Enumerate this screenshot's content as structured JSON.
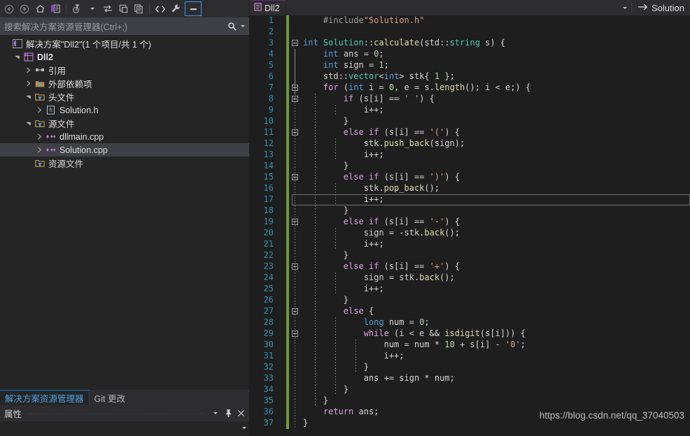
{
  "solution_explorer": {
    "toolbar": [
      {
        "name": "back-icon",
        "title": "Back"
      },
      {
        "name": "forward-icon",
        "title": "Forward"
      },
      {
        "name": "home-icon",
        "title": "Home"
      },
      {
        "name": "sync-with-active-document-icon",
        "title": "Sync"
      },
      {
        "name": "pending-changes-filter-icon",
        "title": "Filter"
      },
      {
        "name": "refresh-icon",
        "title": "Refresh"
      },
      {
        "name": "collapse-all-icon",
        "title": "Collapse All"
      },
      {
        "name": "show-all-files-icon",
        "title": "Show All Files"
      },
      {
        "name": "code-view-icon",
        "title": "View Code"
      },
      {
        "name": "properties-wrench-icon",
        "title": "Properties"
      },
      {
        "name": "preview-selected-items-icon",
        "title": "Preview Selected Items"
      }
    ],
    "search": {
      "placeholder": "搜索解决方案资源管理器(Ctrl+;)",
      "icon": "search-icon",
      "dropdown_icon": "chevron-down-icon"
    },
    "tree": [
      {
        "label": "解决方案\"Dll2\"(1 个项目/共 1 个)",
        "indent": 0,
        "expander": "none",
        "icon": "visual-studio-solution-icon",
        "bold": false,
        "selected": false
      },
      {
        "label": "Dll2",
        "indent": 1,
        "expander": "expanded",
        "icon": "project-icon",
        "bold": true,
        "selected": false
      },
      {
        "label": "引用",
        "indent": 2,
        "expander": "collapsed",
        "icon": "references-icon",
        "bold": false,
        "selected": false
      },
      {
        "label": "外部依赖项",
        "indent": 2,
        "expander": "collapsed",
        "icon": "external-dependencies-icon",
        "bold": false,
        "selected": false
      },
      {
        "label": "头文件",
        "indent": 2,
        "expander": "expanded",
        "icon": "filter-folder-icon",
        "bold": false,
        "selected": false
      },
      {
        "label": "Solution.h",
        "indent": 3,
        "expander": "collapsed",
        "icon": "header-file-icon",
        "bold": false,
        "selected": false
      },
      {
        "label": "源文件",
        "indent": 2,
        "expander": "expanded",
        "icon": "filter-folder-icon",
        "bold": false,
        "selected": false
      },
      {
        "label": "dllmain.cpp",
        "indent": 3,
        "expander": "collapsed",
        "icon": "cpp-file-icon",
        "bold": false,
        "selected": false
      },
      {
        "label": "Solution.cpp",
        "indent": 3,
        "expander": "collapsed",
        "icon": "cpp-file-icon",
        "bold": false,
        "selected": true
      },
      {
        "label": "资源文件",
        "indent": 2,
        "expander": "none",
        "icon": "filter-folder-icon",
        "bold": false,
        "selected": false
      }
    ],
    "bottom_tabs": [
      {
        "label": "解决方案资源管理器",
        "active": true
      },
      {
        "label": "Git 更改",
        "active": false
      }
    ]
  },
  "properties_panel": {
    "title": "属性",
    "buttons": [
      {
        "name": "window-dropdown-icon"
      },
      {
        "name": "pin-icon"
      },
      {
        "name": "close-icon"
      }
    ]
  },
  "editor": {
    "tab": {
      "label": "Dll2",
      "icon": "document-icon"
    },
    "tabstrip_dropdown_icon": "chevron-down-icon",
    "solution_button": {
      "label": "Solution",
      "icon": "arrow-right-icon"
    },
    "caret_line": 17,
    "lines": [
      {
        "n": 1,
        "fold": false,
        "bars": 0,
        "solidbar": false,
        "tokens": [
          {
            "t": "    ",
            "c": "plain"
          },
          {
            "t": "#include",
            "c": "pp"
          },
          {
            "t": "\"Solution.h\"",
            "c": "str"
          }
        ]
      },
      {
        "n": 2,
        "fold": false,
        "bars": 0,
        "solidbar": false,
        "tokens": []
      },
      {
        "n": 3,
        "fold": true,
        "bars": 0,
        "solidbar": false,
        "tokens": [
          {
            "t": "int",
            "c": "kw"
          },
          {
            "t": " ",
            "c": "plain"
          },
          {
            "t": "Solution",
            "c": "typ"
          },
          {
            "t": "::",
            "c": "plain"
          },
          {
            "t": "calculate",
            "c": "fn"
          },
          {
            "t": "(",
            "c": "plain"
          },
          {
            "t": "std",
            "c": "plain"
          },
          {
            "t": "::",
            "c": "plain"
          },
          {
            "t": "string",
            "c": "typ"
          },
          {
            "t": " s) {",
            "c": "plain"
          }
        ]
      },
      {
        "n": 4,
        "fold": false,
        "bars": 1,
        "solidbar": true,
        "tokens": [
          {
            "t": "    ",
            "c": "plain"
          },
          {
            "t": "int",
            "c": "kw"
          },
          {
            "t": " ans = ",
            "c": "plain"
          },
          {
            "t": "0",
            "c": "num"
          },
          {
            "t": ";",
            "c": "plain"
          }
        ]
      },
      {
        "n": 5,
        "fold": false,
        "bars": 1,
        "solidbar": true,
        "tokens": [
          {
            "t": "    ",
            "c": "plain"
          },
          {
            "t": "int",
            "c": "kw"
          },
          {
            "t": " sign = ",
            "c": "plain"
          },
          {
            "t": "1",
            "c": "num"
          },
          {
            "t": ";",
            "c": "plain"
          }
        ]
      },
      {
        "n": 6,
        "fold": false,
        "bars": 1,
        "solidbar": true,
        "tokens": [
          {
            "t": "    std::",
            "c": "plain"
          },
          {
            "t": "vector",
            "c": "typ"
          },
          {
            "t": "<",
            "c": "plain"
          },
          {
            "t": "int",
            "c": "kw"
          },
          {
            "t": "> stk{ ",
            "c": "plain"
          },
          {
            "t": "1",
            "c": "num"
          },
          {
            "t": " };",
            "c": "plain"
          }
        ]
      },
      {
        "n": 7,
        "fold": true,
        "bars": 1,
        "solidbar": true,
        "tokens": [
          {
            "t": "    ",
            "c": "plain"
          },
          {
            "t": "for",
            "c": "ctrl"
          },
          {
            "t": " (",
            "c": "plain"
          },
          {
            "t": "int",
            "c": "kw"
          },
          {
            "t": " i = ",
            "c": "plain"
          },
          {
            "t": "0",
            "c": "num"
          },
          {
            "t": ", e = s.",
            "c": "plain"
          },
          {
            "t": "length",
            "c": "fn"
          },
          {
            "t": "(); i < e;) {",
            "c": "plain"
          }
        ]
      },
      {
        "n": 8,
        "fold": true,
        "bars": 2,
        "solidbar": false,
        "tokens": [
          {
            "t": "        ",
            "c": "plain"
          },
          {
            "t": "if",
            "c": "ctrl"
          },
          {
            "t": " (s[i] == ",
            "c": "plain"
          },
          {
            "t": "' '",
            "c": "str"
          },
          {
            "t": ") {",
            "c": "plain"
          }
        ]
      },
      {
        "n": 9,
        "fold": false,
        "bars": 3,
        "solidbar": false,
        "tokens": [
          {
            "t": "            i++;",
            "c": "plain"
          }
        ]
      },
      {
        "n": 10,
        "fold": false,
        "bars": 2,
        "solidbar": false,
        "tokens": [
          {
            "t": "        }",
            "c": "plain"
          }
        ]
      },
      {
        "n": 11,
        "fold": true,
        "bars": 2,
        "solidbar": false,
        "tokens": [
          {
            "t": "        ",
            "c": "plain"
          },
          {
            "t": "else if",
            "c": "ctrl"
          },
          {
            "t": " (s[i] == ",
            "c": "plain"
          },
          {
            "t": "'('",
            "c": "str"
          },
          {
            "t": ") {",
            "c": "plain"
          }
        ]
      },
      {
        "n": 12,
        "fold": false,
        "bars": 3,
        "solidbar": false,
        "tokens": [
          {
            "t": "            stk.",
            "c": "plain"
          },
          {
            "t": "push_back",
            "c": "fn"
          },
          {
            "t": "(sign);",
            "c": "plain"
          }
        ]
      },
      {
        "n": 13,
        "fold": false,
        "bars": 3,
        "solidbar": false,
        "tokens": [
          {
            "t": "            i++;",
            "c": "plain"
          }
        ]
      },
      {
        "n": 14,
        "fold": false,
        "bars": 2,
        "solidbar": false,
        "tokens": [
          {
            "t": "        }",
            "c": "plain"
          }
        ]
      },
      {
        "n": 15,
        "fold": true,
        "bars": 2,
        "solidbar": false,
        "tokens": [
          {
            "t": "        ",
            "c": "plain"
          },
          {
            "t": "else if",
            "c": "ctrl"
          },
          {
            "t": " (s[i] == ",
            "c": "plain"
          },
          {
            "t": "')'",
            "c": "str"
          },
          {
            "t": ") {",
            "c": "plain"
          }
        ]
      },
      {
        "n": 16,
        "fold": false,
        "bars": 3,
        "solidbar": false,
        "tokens": [
          {
            "t": "            stk.",
            "c": "plain"
          },
          {
            "t": "pop_back",
            "c": "fn"
          },
          {
            "t": "();",
            "c": "plain"
          }
        ]
      },
      {
        "n": 17,
        "fold": false,
        "bars": 3,
        "solidbar": false,
        "tokens": [
          {
            "t": "            i++;",
            "c": "plain"
          }
        ]
      },
      {
        "n": 18,
        "fold": false,
        "bars": 2,
        "solidbar": false,
        "tokens": [
          {
            "t": "        }",
            "c": "plain"
          }
        ]
      },
      {
        "n": 19,
        "fold": true,
        "bars": 2,
        "solidbar": false,
        "tokens": [
          {
            "t": "        ",
            "c": "plain"
          },
          {
            "t": "else if",
            "c": "ctrl"
          },
          {
            "t": " (s[i] == ",
            "c": "plain"
          },
          {
            "t": "'-'",
            "c": "str"
          },
          {
            "t": ") {",
            "c": "plain"
          }
        ]
      },
      {
        "n": 20,
        "fold": false,
        "bars": 3,
        "solidbar": false,
        "tokens": [
          {
            "t": "            sign = -stk.",
            "c": "plain"
          },
          {
            "t": "back",
            "c": "fn"
          },
          {
            "t": "();",
            "c": "plain"
          }
        ]
      },
      {
        "n": 21,
        "fold": false,
        "bars": 3,
        "solidbar": false,
        "tokens": [
          {
            "t": "            i++;",
            "c": "plain"
          }
        ]
      },
      {
        "n": 22,
        "fold": false,
        "bars": 2,
        "solidbar": false,
        "tokens": [
          {
            "t": "        }",
            "c": "plain"
          }
        ]
      },
      {
        "n": 23,
        "fold": true,
        "bars": 2,
        "solidbar": false,
        "tokens": [
          {
            "t": "        ",
            "c": "plain"
          },
          {
            "t": "else if",
            "c": "ctrl"
          },
          {
            "t": " (s[i] == ",
            "c": "plain"
          },
          {
            "t": "'+'",
            "c": "str"
          },
          {
            "t": ") {",
            "c": "plain"
          }
        ]
      },
      {
        "n": 24,
        "fold": false,
        "bars": 3,
        "solidbar": false,
        "tokens": [
          {
            "t": "            sign = stk.",
            "c": "plain"
          },
          {
            "t": "back",
            "c": "fn"
          },
          {
            "t": "();",
            "c": "plain"
          }
        ]
      },
      {
        "n": 25,
        "fold": false,
        "bars": 3,
        "solidbar": false,
        "tokens": [
          {
            "t": "            i++;",
            "c": "plain"
          }
        ]
      },
      {
        "n": 26,
        "fold": false,
        "bars": 2,
        "solidbar": false,
        "tokens": [
          {
            "t": "        }",
            "c": "plain"
          }
        ]
      },
      {
        "n": 27,
        "fold": true,
        "bars": 2,
        "solidbar": false,
        "tokens": [
          {
            "t": "        ",
            "c": "plain"
          },
          {
            "t": "else",
            "c": "ctrl"
          },
          {
            "t": " {",
            "c": "plain"
          }
        ]
      },
      {
        "n": 28,
        "fold": false,
        "bars": 3,
        "solidbar": false,
        "tokens": [
          {
            "t": "            ",
            "c": "plain"
          },
          {
            "t": "long",
            "c": "kw"
          },
          {
            "t": " num = ",
            "c": "plain"
          },
          {
            "t": "0",
            "c": "num"
          },
          {
            "t": ";",
            "c": "plain"
          }
        ]
      },
      {
        "n": 29,
        "fold": true,
        "bars": 3,
        "solidbar": false,
        "tokens": [
          {
            "t": "            ",
            "c": "plain"
          },
          {
            "t": "while",
            "c": "ctrl"
          },
          {
            "t": " (i < e && ",
            "c": "plain"
          },
          {
            "t": "isdigit",
            "c": "fn"
          },
          {
            "t": "(s[i])) {",
            "c": "plain"
          }
        ]
      },
      {
        "n": 30,
        "fold": false,
        "bars": 4,
        "solidbar": false,
        "tokens": [
          {
            "t": "                num = num * ",
            "c": "plain"
          },
          {
            "t": "10",
            "c": "num"
          },
          {
            "t": " + s[i] - ",
            "c": "plain"
          },
          {
            "t": "'0'",
            "c": "str"
          },
          {
            "t": ";",
            "c": "plain"
          }
        ]
      },
      {
        "n": 31,
        "fold": false,
        "bars": 4,
        "solidbar": false,
        "tokens": [
          {
            "t": "                i++;",
            "c": "plain"
          }
        ]
      },
      {
        "n": 32,
        "fold": false,
        "bars": 4,
        "solidbar": false,
        "tokens": [
          {
            "t": "            }",
            "c": "plain"
          }
        ]
      },
      {
        "n": 33,
        "fold": false,
        "bars": 3,
        "solidbar": false,
        "tokens": [
          {
            "t": "            ans += sign * num;",
            "c": "plain"
          }
        ]
      },
      {
        "n": 34,
        "fold": false,
        "bars": 3,
        "solidbar": false,
        "tokens": [
          {
            "t": "        }",
            "c": "plain"
          }
        ]
      },
      {
        "n": 35,
        "fold": false,
        "bars": 2,
        "solidbar": false,
        "tokens": [
          {
            "t": "    }",
            "c": "plain"
          }
        ]
      },
      {
        "n": 36,
        "fold": false,
        "bars": 1,
        "solidbar": false,
        "tokens": [
          {
            "t": "    ",
            "c": "plain"
          },
          {
            "t": "return",
            "c": "ctrl"
          },
          {
            "t": " ans;",
            "c": "plain"
          }
        ]
      },
      {
        "n": 37,
        "fold": false,
        "bars": 1,
        "solidbar": false,
        "tokens": [
          {
            "t": "}",
            "c": "plain"
          }
        ]
      }
    ]
  },
  "watermark": "https://blog.csdn.net/qq_37040503",
  "colors": {
    "accent_blue": "#007acc",
    "selection": "#3f3f46",
    "editor_bg": "#1e1e1e",
    "panel_bg": "#252526",
    "toolbar_bg": "#2d2d30",
    "change_bar_green": "#6f9a3a",
    "tab_accent_purple": "#68217a",
    "line_number": "#2b91af"
  }
}
